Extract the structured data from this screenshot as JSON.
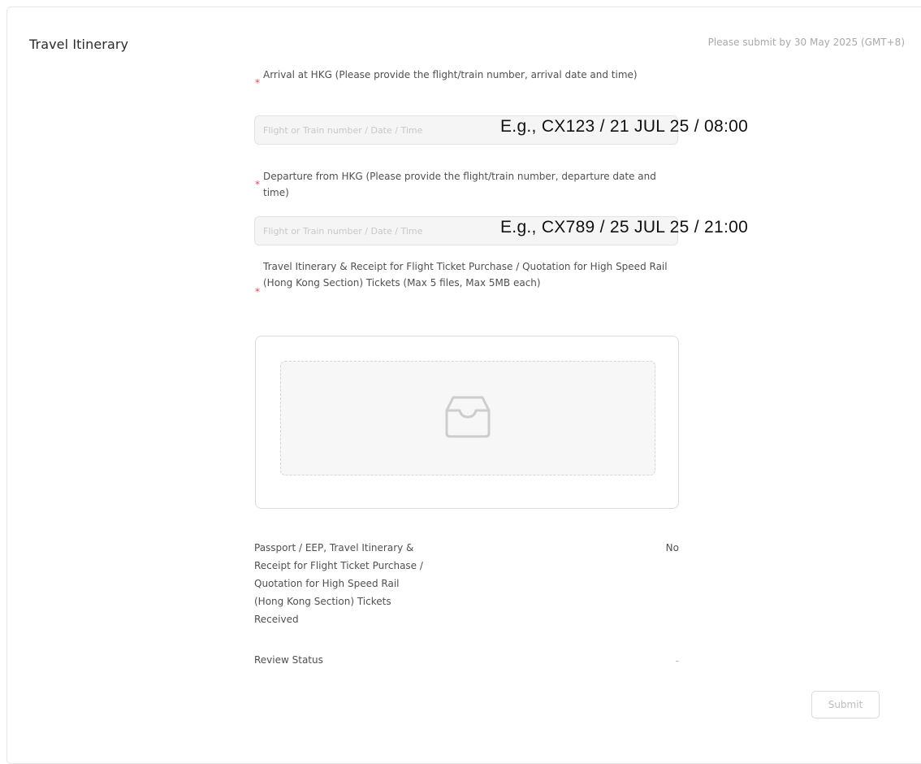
{
  "section": {
    "title": "Travel Itinerary",
    "deadline": "Please submit by 30 May 2025 (GMT+8)"
  },
  "required_mark": "*",
  "arrival": {
    "label": "Arrival at HKG (Please provide the flight/train number, arrival date and time)",
    "placeholder": "Flight or Train number / Date / Time",
    "value": "",
    "example": "E.g., CX123 / 21 JUL 25 / 08:00"
  },
  "departure": {
    "label": "Departure from HKG (Please provide the flight/train number, departure date and time)",
    "placeholder": "Flight or Train number / Date / Time",
    "value": "",
    "example": "E.g., CX789 / 25 JUL 25 / 21:00"
  },
  "upload": {
    "label": "Travel Itinerary & Receipt for Flight Ticket Purchase / Quotation for High Speed Rail (Hong Kong Section) Tickets (Max 5 files, Max 5MB each)",
    "icon": "inbox-icon"
  },
  "received": {
    "label_lines": [
      "Passport / EEP, Travel Itinerary &",
      "Receipt for Flight Ticket Purchase /",
      "Quotation for High Speed Rail",
      "(Hong Kong Section) Tickets",
      "Received"
    ],
    "value": "No"
  },
  "review": {
    "label": "Review Status",
    "value": "-"
  },
  "actions": {
    "submit_label": "Submit"
  },
  "colors": {
    "required": "#e5484d",
    "muted_text": "#a9a9a9",
    "input_bg": "#f5f5f5",
    "border": "#e3e3e3"
  }
}
